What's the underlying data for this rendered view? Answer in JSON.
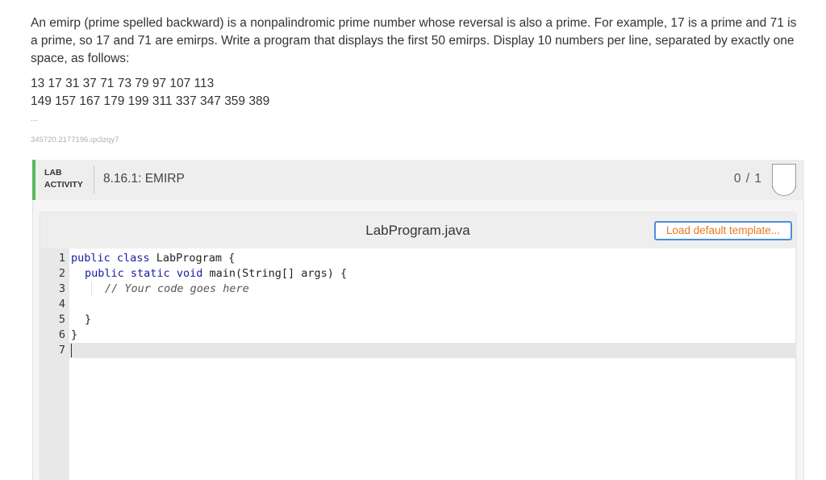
{
  "prompt": {
    "text": "An emirp (prime spelled backward) is a nonpalindromic prime number whose reversal is also a prime. For example, 17 is a prime and 71 is a prime, so 17 and 71 are emirps. Write a program that displays the first 50 emirps. Display 10 numbers per line, separated by exactly one space, as follows:",
    "sample_line_1": "13 17 31 37 71 73 79 97 107 113",
    "sample_line_2": "149 157 167 179 199 311 337 347 359 389",
    "ellipsis": "...",
    "file_id": "345720.2177196.qx3zqy7"
  },
  "lab": {
    "tag_line_1": "LAB",
    "tag_line_2": "ACTIVITY",
    "title": "8.16.1: EMIRP",
    "score": "0 / 1",
    "accent_color": "#5cb85c"
  },
  "editor": {
    "filename": "LabProgram.java",
    "load_template_label": "Load default template...",
    "line_numbers": [
      "1",
      "2",
      "3",
      "4",
      "5",
      "6",
      "7"
    ],
    "code": {
      "l1_kw1": "public",
      "l1_kw2": "class",
      "l1_rest": " LabProgram {",
      "l2_kw1": "public",
      "l2_kw2": "static",
      "l2_kw3": "void",
      "l2_rest": " main(String[] args) {",
      "l3_comment": "// Your code goes here",
      "l5": "}",
      "l6": "}"
    }
  }
}
